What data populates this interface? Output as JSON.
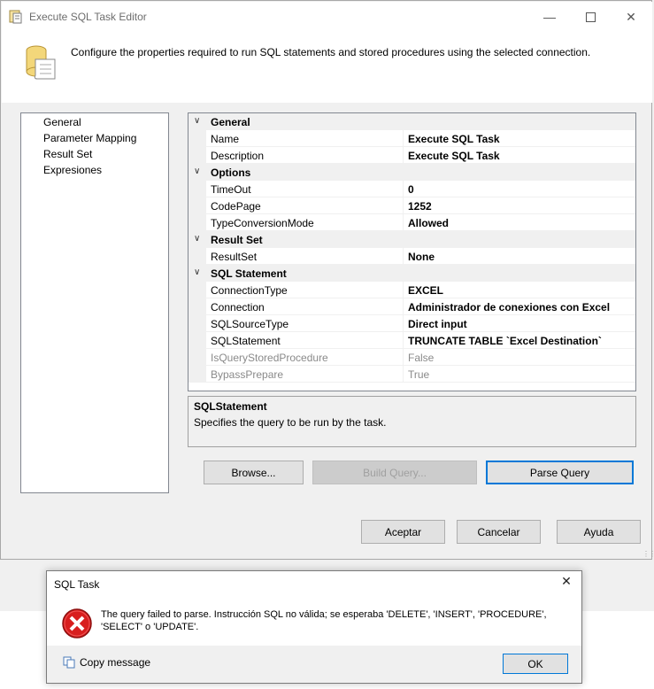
{
  "window": {
    "title": "Execute SQL Task Editor",
    "header_text": "Configure the properties required to run SQL statements and stored procedures using the selected connection."
  },
  "nav": {
    "items": [
      {
        "label": "General"
      },
      {
        "label": "Parameter Mapping"
      },
      {
        "label": "Result Set"
      },
      {
        "label": "Expresiones"
      }
    ]
  },
  "grid": {
    "categories": [
      {
        "label": "General",
        "props": [
          {
            "name": "Name",
            "value": "Execute SQL Task"
          },
          {
            "name": "Description",
            "value": "Execute SQL Task"
          }
        ]
      },
      {
        "label": "Options",
        "props": [
          {
            "name": "TimeOut",
            "value": "0"
          },
          {
            "name": "CodePage",
            "value": "1252"
          },
          {
            "name": "TypeConversionMode",
            "value": "Allowed"
          }
        ]
      },
      {
        "label": "Result Set",
        "props": [
          {
            "name": "ResultSet",
            "value": "None"
          }
        ]
      },
      {
        "label": "SQL Statement",
        "props": [
          {
            "name": "ConnectionType",
            "value": "EXCEL"
          },
          {
            "name": "Connection",
            "value": "Administrador de conexiones con Excel"
          },
          {
            "name": "SQLSourceType",
            "value": "Direct input"
          },
          {
            "name": "SQLStatement",
            "value": "TRUNCATE TABLE `Excel Destination`"
          },
          {
            "name": "IsQueryStoredProcedure",
            "value": "False"
          },
          {
            "name": "BypassPrepare",
            "value": "True"
          }
        ]
      }
    ]
  },
  "description": {
    "title": "SQLStatement",
    "text": "Specifies the query to be run by the task."
  },
  "buttons": {
    "browse": "Browse...",
    "build_query": "Build Query...",
    "parse_query": "Parse Query",
    "accept": "Aceptar",
    "cancel": "Cancelar",
    "help": "Ayuda"
  },
  "dialog": {
    "title": "SQL Task",
    "message": "The query failed to parse. Instrucción SQL no válida; se esperaba 'DELETE', 'INSERT', 'PROCEDURE', 'SELECT' o 'UPDATE'.",
    "copy_label": "Copy message",
    "ok": "OK"
  },
  "colors": {
    "accent": "#0078d7",
    "error": "#d81e1e"
  }
}
